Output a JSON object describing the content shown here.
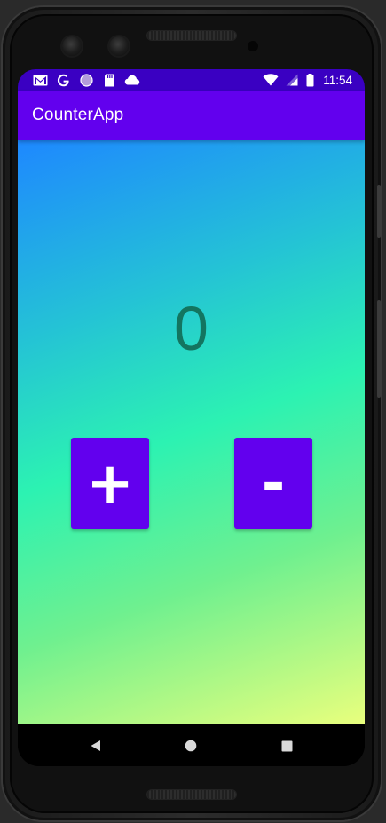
{
  "status_bar": {
    "time": "11:54",
    "left_icons": [
      "gmail-icon",
      "google-icon",
      "circle-app-icon",
      "sd-card-icon",
      "cloud-icon"
    ],
    "right_icons": [
      "wifi-icon",
      "signal-icon",
      "battery-icon"
    ]
  },
  "app_bar": {
    "title": "CounterApp"
  },
  "counter": {
    "value": "0"
  },
  "buttons": {
    "increment_label": "+",
    "decrement_label": "-"
  },
  "nav_bar": {
    "items": [
      "back-icon",
      "home-icon",
      "recents-icon"
    ]
  },
  "colors": {
    "status_bar": "#3a00c2",
    "app_bar": "#6200ee",
    "button": "#6200ee",
    "counter_text": "#137560",
    "gradient_top": "#1e88ff",
    "gradient_mid": "#2cf2b2",
    "gradient_bottom": "#e9ff7d"
  }
}
